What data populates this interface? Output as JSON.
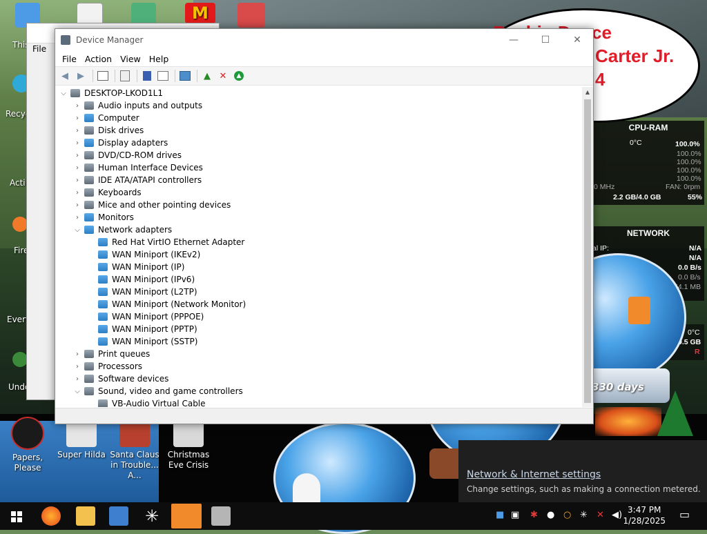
{
  "desktop": {
    "bubble_lines": [
      "Rashin Dance",
      "Carter Jr.",
      "4"
    ],
    "left_edge_labels": [
      "This",
      "Recycle",
      "Acti",
      "Fire",
      "Every",
      "Undo"
    ],
    "bottom_icons": [
      {
        "label": "Papers, Please"
      },
      {
        "label": "Super Hilda"
      },
      {
        "label": "Santa Claus in Trouble... A..."
      },
      {
        "label": "Christmas Eve Crisis"
      }
    ]
  },
  "background_window": {
    "menu_label": "File"
  },
  "device_manager": {
    "title": "Device Manager",
    "controls": {
      "minimize": "—",
      "maximize": "☐",
      "close": "✕"
    },
    "menu": [
      "File",
      "Action",
      "View",
      "Help"
    ],
    "root": "DESKTOP-LKOD1L1",
    "tree": [
      {
        "label": "Audio inputs and outputs",
        "expanded": false,
        "depth": 1
      },
      {
        "label": "Computer",
        "expanded": false,
        "depth": 1
      },
      {
        "label": "Disk drives",
        "expanded": false,
        "depth": 1
      },
      {
        "label": "Display adapters",
        "expanded": false,
        "depth": 1
      },
      {
        "label": "DVD/CD-ROM drives",
        "expanded": false,
        "depth": 1
      },
      {
        "label": "Human Interface Devices",
        "expanded": false,
        "depth": 1
      },
      {
        "label": "IDE ATA/ATAPI controllers",
        "expanded": false,
        "depth": 1
      },
      {
        "label": "Keyboards",
        "expanded": false,
        "depth": 1
      },
      {
        "label": "Mice and other pointing devices",
        "expanded": false,
        "depth": 1
      },
      {
        "label": "Monitors",
        "expanded": false,
        "depth": 1
      },
      {
        "label": "Network adapters",
        "expanded": true,
        "depth": 1
      },
      {
        "label": "Red Hat VirtIO Ethernet Adapter",
        "depth": 2
      },
      {
        "label": "WAN Miniport (IKEv2)",
        "depth": 2
      },
      {
        "label": "WAN Miniport (IP)",
        "depth": 2
      },
      {
        "label": "WAN Miniport (IPv6)",
        "depth": 2
      },
      {
        "label": "WAN Miniport (L2TP)",
        "depth": 2
      },
      {
        "label": "WAN Miniport (Network Monitor)",
        "depth": 2
      },
      {
        "label": "WAN Miniport (PPPOE)",
        "depth": 2
      },
      {
        "label": "WAN Miniport (PPTP)",
        "depth": 2
      },
      {
        "label": "WAN Miniport (SSTP)",
        "depth": 2
      },
      {
        "label": "Print queues",
        "expanded": false,
        "depth": 1
      },
      {
        "label": "Processors",
        "expanded": false,
        "depth": 1
      },
      {
        "label": "Software devices",
        "expanded": false,
        "depth": 1
      },
      {
        "label": "Sound, video and game controllers",
        "expanded": true,
        "depth": 1
      },
      {
        "label": "VB-Audio Virtual Cable",
        "depth": 2
      }
    ]
  },
  "gadgets": {
    "cpu_ram": {
      "title": "CPU-RAM",
      "temp": "0°C",
      "cpu_pct": "100.0%",
      "core_pcts": [
        "100.0%",
        "100.0%",
        "100.0%",
        "100.0%"
      ],
      "freq": "0 MHz",
      "fan": "FAN: 0rpm",
      "ram": "2.2 GB/4.0 GB",
      "ram_pct": "55%"
    },
    "network": {
      "title": "NETWORK",
      "ip_label": "al IP:",
      "ip_value": "N/A",
      "ip_value2": "N/A",
      "speed1": "0.0 B/s",
      "speed2": "0.0 B/s",
      "total": "54.1 MB"
    },
    "drive": {
      "temp": "0°C",
      "size": "9.5 GB",
      "label": "R"
    },
    "days_badge": "330 days"
  },
  "toast": {
    "title": "Network & Internet settings",
    "subtitle": "Change settings, such as making a connection metered."
  },
  "taskbar": {
    "time": "3:47 PM",
    "date": "1/28/2025"
  }
}
